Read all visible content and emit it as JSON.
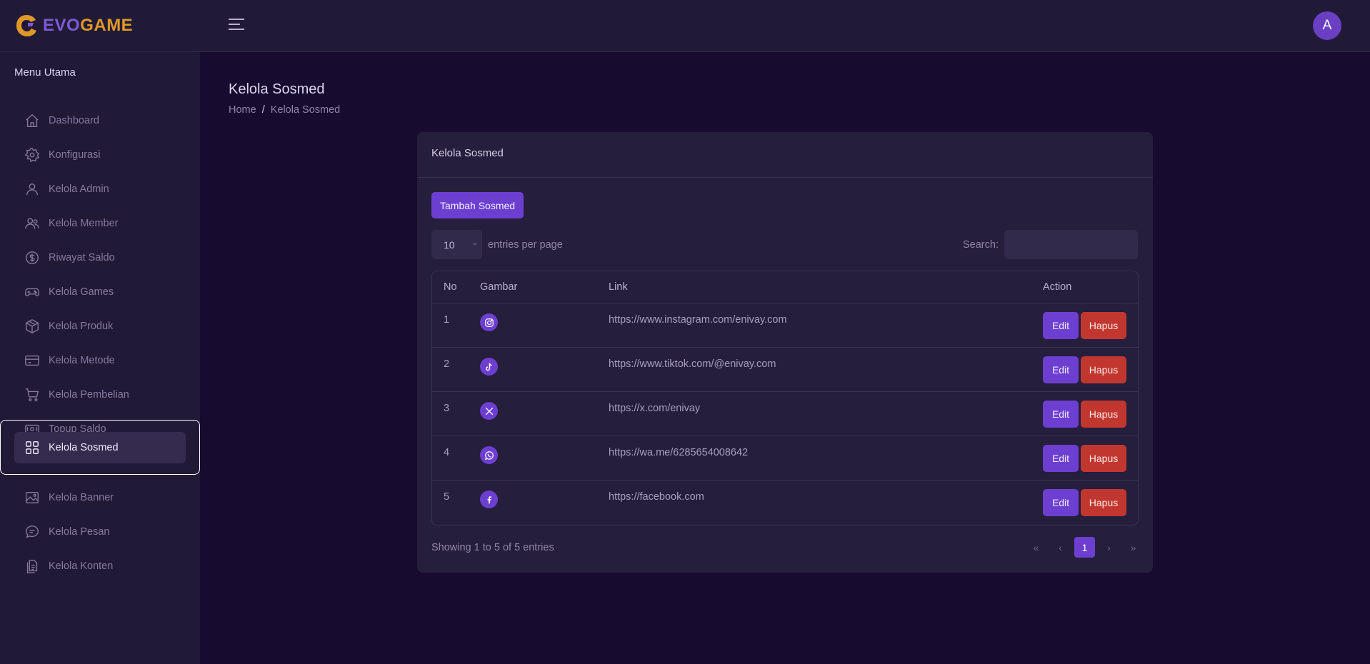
{
  "brand": {
    "part1": "EVO",
    "part2": "GAME"
  },
  "user": {
    "avatar_initial": "A"
  },
  "sidebar": {
    "heading": "Menu Utama",
    "items": [
      {
        "label": "Dashboard",
        "icon": "home-icon"
      },
      {
        "label": "Konfigurasi",
        "icon": "gear-icon"
      },
      {
        "label": "Kelola Admin",
        "icon": "user-icon"
      },
      {
        "label": "Kelola Member",
        "icon": "users-icon"
      },
      {
        "label": "Riwayat Saldo",
        "icon": "dollar-circle-icon"
      },
      {
        "label": "Kelola Games",
        "icon": "gamepad-icon"
      },
      {
        "label": "Kelola Produk",
        "icon": "box-icon"
      },
      {
        "label": "Kelola Metode",
        "icon": "credit-card-icon"
      },
      {
        "label": "Kelola Pembelian",
        "icon": "cart-icon"
      },
      {
        "label": "Topup Saldo",
        "icon": "cash-icon"
      },
      {
        "label": "Kelola Sosmed",
        "icon": "grid-icon",
        "active": true
      },
      {
        "label": "Kelola Banner",
        "icon": "image-icon"
      },
      {
        "label": "Kelola Pesan",
        "icon": "chat-icon"
      },
      {
        "label": "Kelola Konten",
        "icon": "document-icon"
      }
    ]
  },
  "page": {
    "title": "Kelola Sosmed",
    "breadcrumb": {
      "home": "Home",
      "separator": "/",
      "current": "Kelola Sosmed"
    }
  },
  "card": {
    "title": "Kelola Sosmed",
    "add_button": "Tambah Sosmed",
    "entries_value": "10",
    "entries_label": "entries per page",
    "search_label": "Search:",
    "search_value": "",
    "columns": {
      "no": "No",
      "image": "Gambar",
      "link": "Link",
      "action": "Action"
    },
    "rows": [
      {
        "no": "1",
        "icon": "instagram-icon",
        "link": "https://www.instagram.com/enivay.com"
      },
      {
        "no": "2",
        "icon": "tiktok-icon",
        "link": "https://www.tiktok.com/@enivay.com"
      },
      {
        "no": "3",
        "icon": "x-twitter-icon",
        "link": "https://x.com/enivay"
      },
      {
        "no": "4",
        "icon": "whatsapp-icon",
        "link": "https://wa.me/6285654008642"
      },
      {
        "no": "5",
        "icon": "facebook-icon",
        "link": "https://facebook.com"
      }
    ],
    "edit_label": "Edit",
    "delete_label": "Hapus",
    "info": "Showing 1 to 5 of 5 entries",
    "pagination": {
      "first": "«",
      "prev": "‹",
      "current": "1",
      "next": "›",
      "last": "»"
    }
  },
  "colors": {
    "accent": "#6d3fd1",
    "danger": "#c1372f",
    "brand_orange": "#e0982a",
    "background": "#170b30"
  }
}
